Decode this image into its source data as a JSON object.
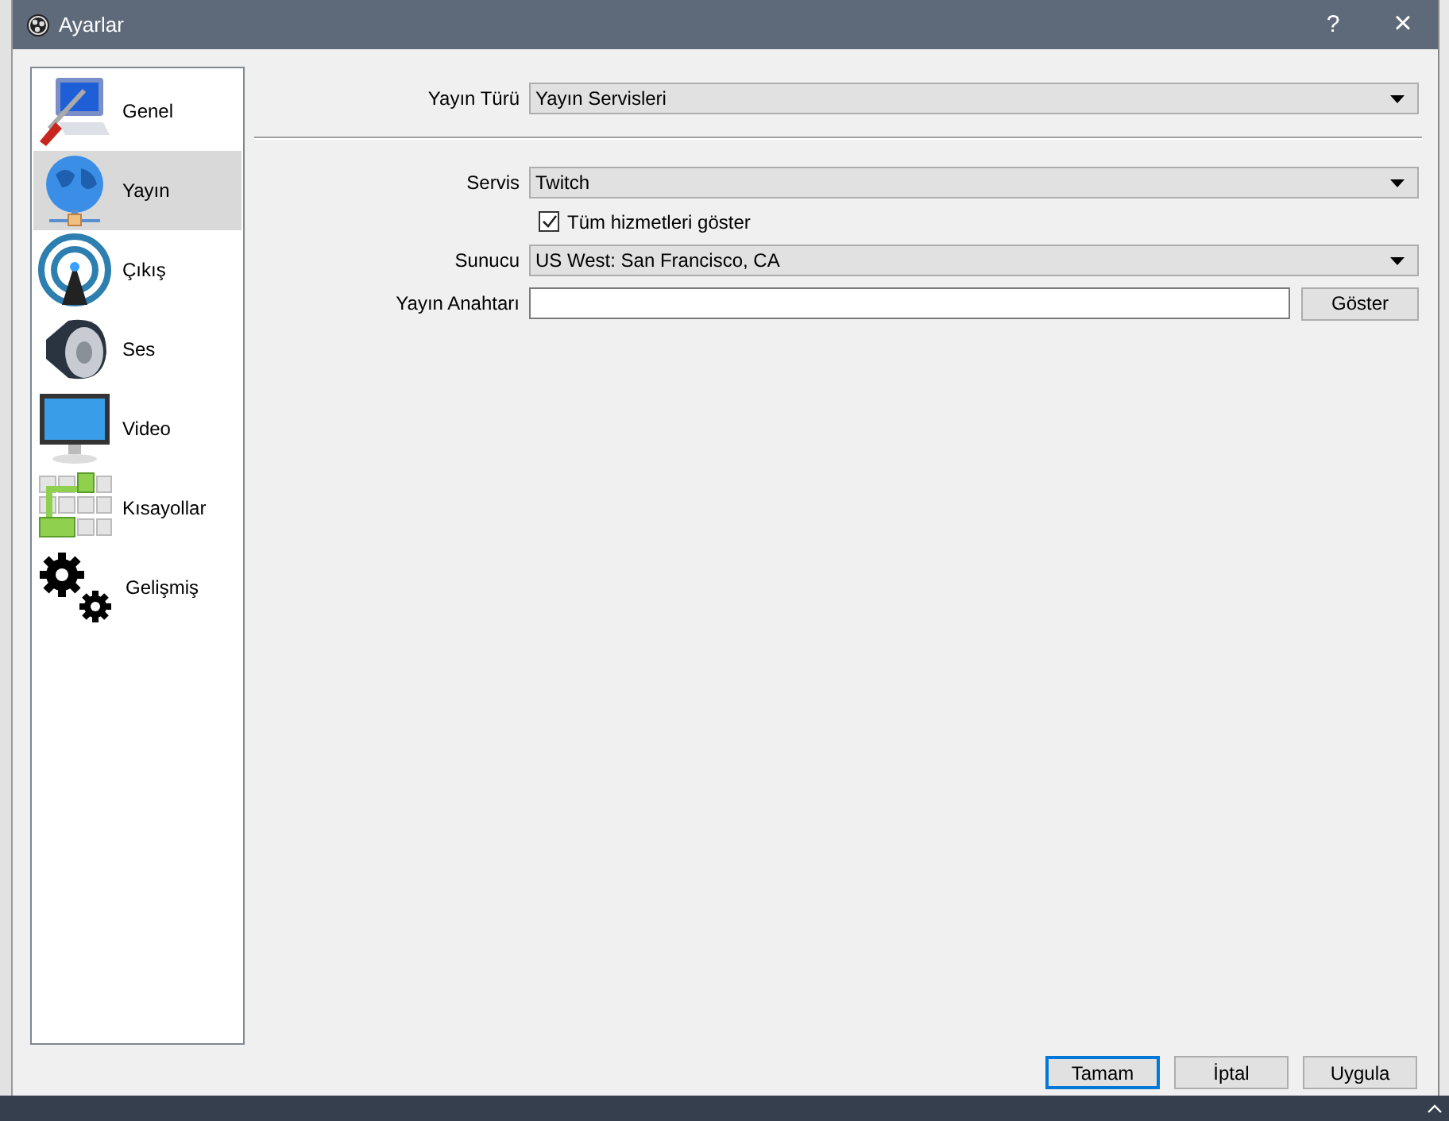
{
  "window": {
    "title": "Ayarlar",
    "help": "?",
    "close": "×"
  },
  "sidebar": {
    "items": [
      {
        "label": "Genel",
        "selected": false
      },
      {
        "label": "Yayın",
        "selected": true
      },
      {
        "label": "Çıkış",
        "selected": false
      },
      {
        "label": "Ses",
        "selected": false
      },
      {
        "label": "Video",
        "selected": false
      },
      {
        "label": "Kısayollar",
        "selected": false
      },
      {
        "label": "Gelişmiş",
        "selected": false
      }
    ]
  },
  "stream_type": {
    "label": "Yayın Türü",
    "value": "Yayın Servisleri"
  },
  "service": {
    "label": "Servis",
    "value": "Twitch"
  },
  "show_all": {
    "label": "Tüm hizmetleri göster",
    "checked": true
  },
  "server": {
    "label": "Sunucu",
    "value": "US West: San Francisco, CA"
  },
  "stream_key": {
    "label": "Yayın Anahtarı",
    "button": "Göster"
  },
  "buttons": [
    {
      "label": "Tamam",
      "focused": true
    },
    {
      "label": "İptal",
      "focused": false
    },
    {
      "label": "Uygula",
      "focused": false
    }
  ]
}
